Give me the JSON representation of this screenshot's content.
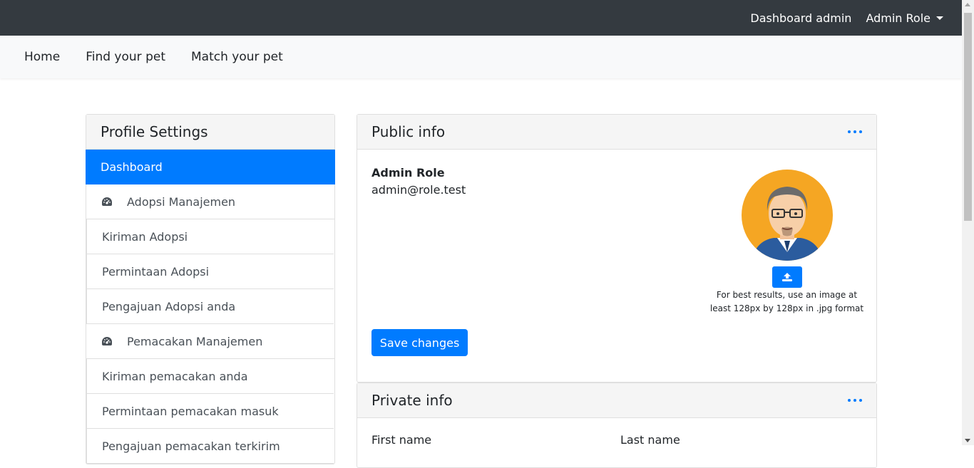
{
  "topbar": {
    "dashboard_link": "Dashboard admin",
    "user_menu": "Admin Role"
  },
  "navbar": {
    "items": [
      "Home",
      "Find your pet",
      "Match your pet"
    ]
  },
  "sidebar": {
    "title": "Profile Settings",
    "items": [
      {
        "label": "Dashboard",
        "active": true
      },
      {
        "label": "Adopsi Manajemen",
        "icon": "tachometer-icon"
      },
      {
        "label": "Kiriman Adopsi"
      },
      {
        "label": "Permintaan Adopsi"
      },
      {
        "label": "Pengajuan Adopsi anda"
      },
      {
        "label": "Pemacakan Manajemen",
        "icon": "tachometer-icon"
      },
      {
        "label": "Kiriman pemacakan anda"
      },
      {
        "label": "Permintaan pemacakan masuk"
      },
      {
        "label": "Pengajuan pemacakan terkirim"
      }
    ]
  },
  "public_info": {
    "title": "Public info",
    "name": "Admin Role",
    "email": "admin@role.test",
    "upload_hint": "For best results, use an image at least 128px by 128px in .jpg format",
    "save_label": "Save changes"
  },
  "private_info": {
    "title": "Private info",
    "first_name_label": "First name",
    "last_name_label": "Last name"
  },
  "colors": {
    "primary": "#007bff",
    "topbar": "#343a40",
    "navbar": "#f8f9fa"
  }
}
